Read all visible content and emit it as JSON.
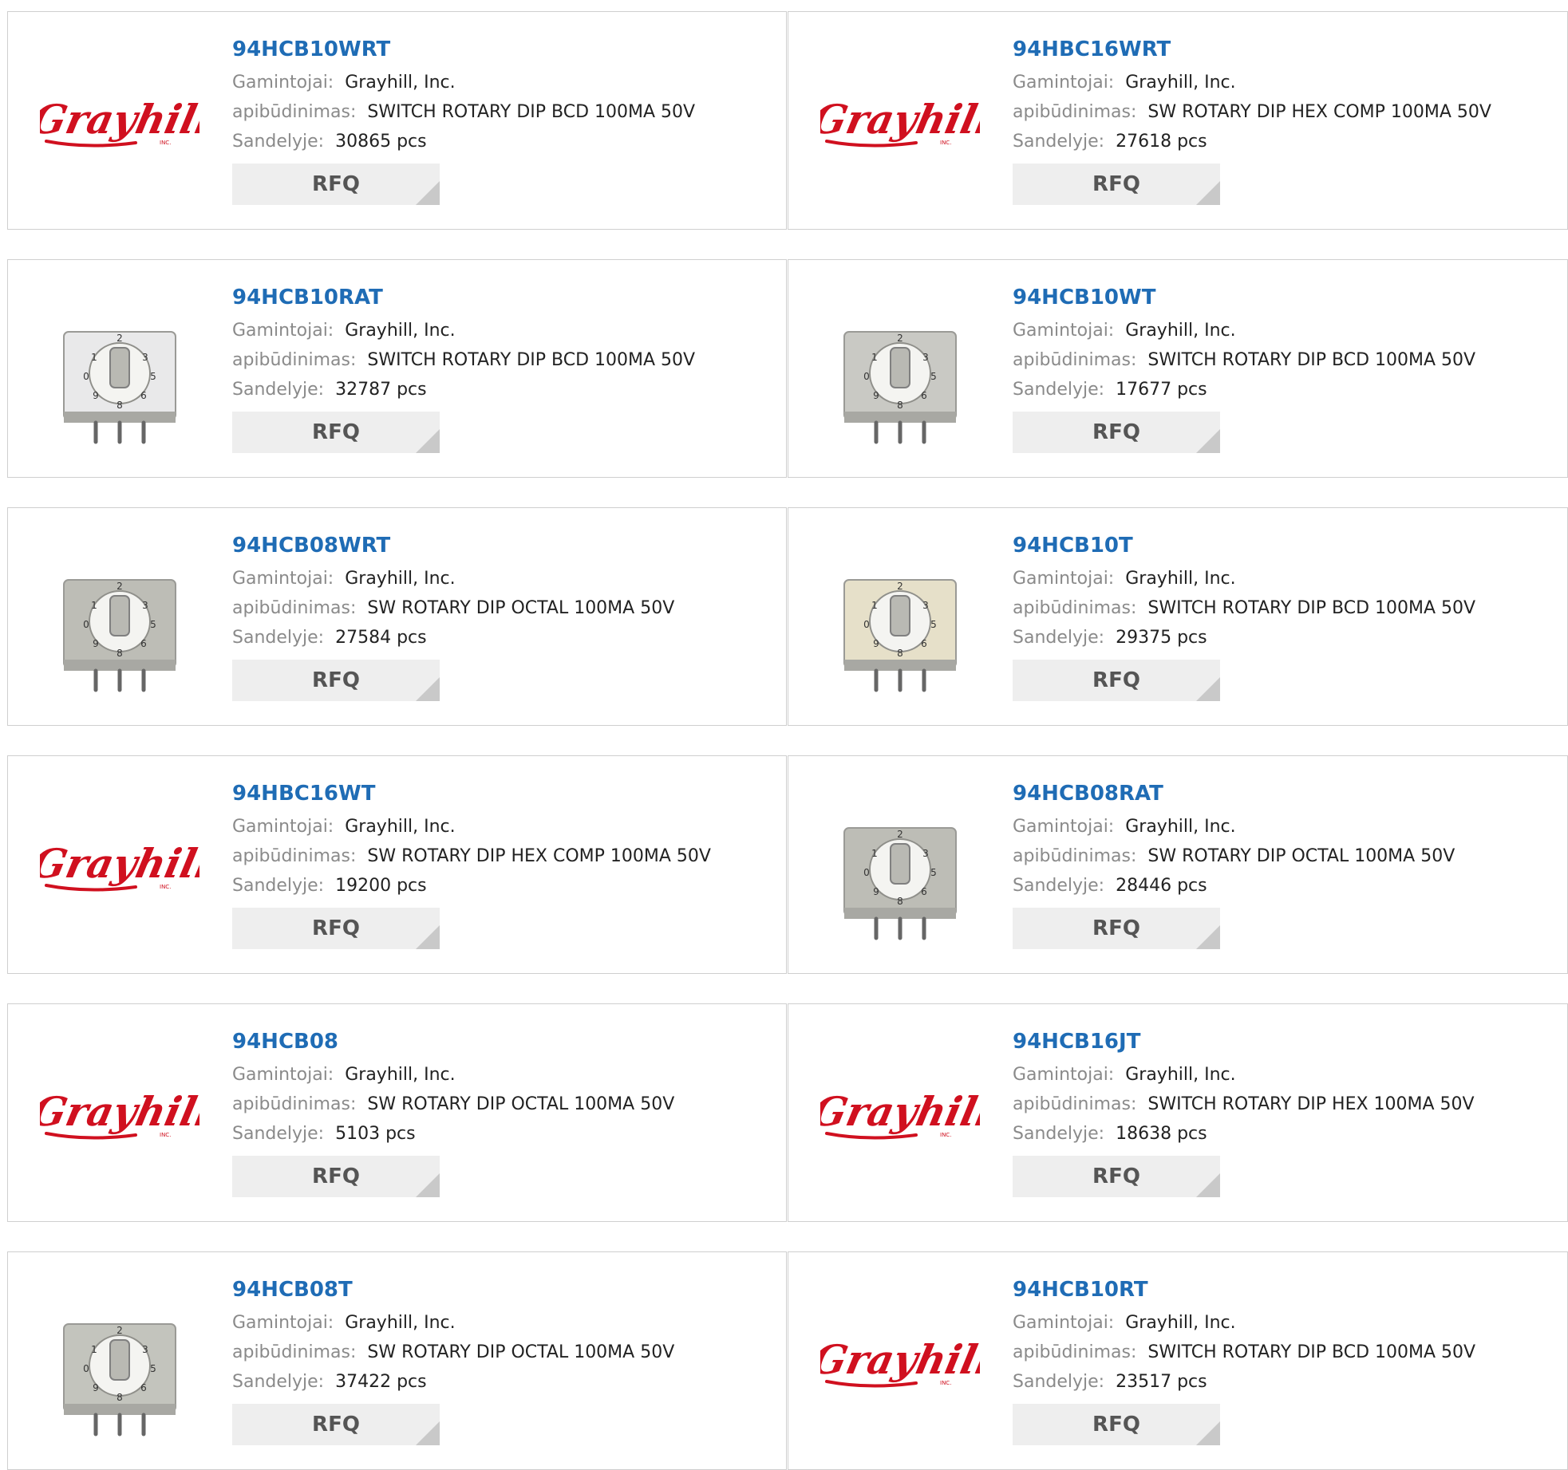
{
  "labels": {
    "manufacturer": "Gamintojai:",
    "description": "apibūdinimas:",
    "stock": "Sandelyje:"
  },
  "rfq_label": "RFQ",
  "colors": {
    "title": "#1f6cb5",
    "logo": "#d0101f",
    "rfq_bg": "#eeeeee"
  },
  "products": [
    {
      "part": "94HCB10WRT",
      "manufacturer": "Grayhill, Inc.",
      "description": "SWITCH ROTARY DIP BCD 100MA 50V",
      "stock": "30865 pcs",
      "image": "grayhill-logo"
    },
    {
      "part": "94HBC16WRT",
      "manufacturer": "Grayhill, Inc.",
      "description": "SW ROTARY DIP HEX COMP 100MA 50V",
      "stock": "27618 pcs",
      "image": "grayhill-logo"
    },
    {
      "part": "94HCB10RAT",
      "manufacturer": "Grayhill, Inc.",
      "description": "SWITCH ROTARY DIP BCD 100MA 50V",
      "stock": "32787 pcs",
      "image": "rotary-switch-photo-white"
    },
    {
      "part": "94HCB10WT",
      "manufacturer": "Grayhill, Inc.",
      "description": "SWITCH ROTARY DIP BCD 100MA 50V",
      "stock": "17677 pcs",
      "image": "rotary-switch-photo-smd"
    },
    {
      "part": "94HCB08WRT",
      "manufacturer": "Grayhill, Inc.",
      "description": "SW ROTARY DIP OCTAL 100MA 50V",
      "stock": "27584 pcs",
      "image": "rotary-switch-photo-gray"
    },
    {
      "part": "94HCB10T",
      "manufacturer": "Grayhill, Inc.",
      "description": "SWITCH ROTARY DIP BCD 100MA 50V",
      "stock": "29375 pcs",
      "image": "rotary-switch-photo-beige"
    },
    {
      "part": "94HBC16WT",
      "manufacturer": "Grayhill, Inc.",
      "description": "SW ROTARY DIP HEX COMP 100MA 50V",
      "stock": "19200 pcs",
      "image": "grayhill-logo"
    },
    {
      "part": "94HCB08RAT",
      "manufacturer": "Grayhill, Inc.",
      "description": "SW ROTARY DIP OCTAL 100MA 50V",
      "stock": "28446 pcs",
      "image": "rotary-switch-photo-gray"
    },
    {
      "part": "94HCB08",
      "manufacturer": "Grayhill, Inc.",
      "description": "SW ROTARY DIP OCTAL 100MA 50V",
      "stock": "5103 pcs",
      "image": "grayhill-logo"
    },
    {
      "part": "94HCB16JT",
      "manufacturer": "Grayhill, Inc.",
      "description": "SWITCH ROTARY DIP HEX 100MA 50V",
      "stock": "18638 pcs",
      "image": "grayhill-logo"
    },
    {
      "part": "94HCB08T",
      "manufacturer": "Grayhill, Inc.",
      "description": "SW ROTARY DIP OCTAL 100MA 50V",
      "stock": "37422 pcs",
      "image": "rotary-switch-photo-tall"
    },
    {
      "part": "94HCB10RT",
      "manufacturer": "Grayhill, Inc.",
      "description": "SWITCH ROTARY DIP BCD 100MA 50V",
      "stock": "23517 pcs",
      "image": "grayhill-logo"
    }
  ]
}
